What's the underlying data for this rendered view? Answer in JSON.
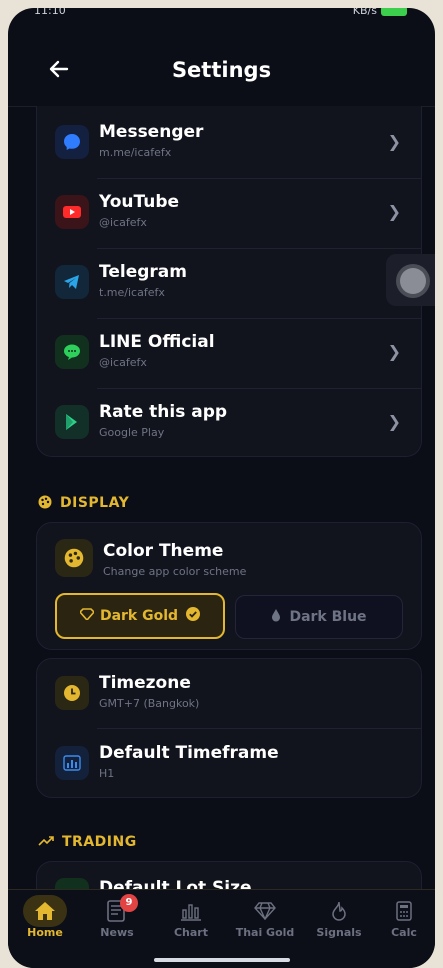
{
  "status": {
    "time": "11:10",
    "right": "KB/s"
  },
  "header": {
    "title": "Settings"
  },
  "social": [
    {
      "label": "Messenger",
      "sub": "m.me/icafefx",
      "icon": "messenger-icon",
      "color": "#2f7cff"
    },
    {
      "label": "YouTube",
      "sub": "@icafefx",
      "icon": "youtube-icon",
      "color": "#ff2a2a"
    },
    {
      "label": "Telegram",
      "sub": "t.me/icafefx",
      "icon": "telegram-icon",
      "color": "#2aa5e8"
    },
    {
      "label": "LINE Official",
      "sub": "@icafefx",
      "icon": "line-icon",
      "color": "#2fcf5c"
    },
    {
      "label": "Rate this app",
      "sub": "Google Play",
      "icon": "google-play-icon",
      "color": "#2fcf8a"
    }
  ],
  "display": {
    "section_label": "DISPLAY",
    "color_theme_title": "Color Theme",
    "color_theme_sub": "Change app color scheme",
    "dark_gold": "Dark Gold",
    "dark_blue": "Dark Blue",
    "selected": "Dark Gold"
  },
  "timezone": {
    "title": "Timezone",
    "sub": "GMT+7 (Bangkok)"
  },
  "timeframe": {
    "title": "Default Timeframe",
    "sub": "H1"
  },
  "trading": {
    "section_label": "TRADING",
    "first_item": "Default Lot Size"
  },
  "nav": [
    {
      "label": "Home",
      "icon": "home-icon",
      "active": true
    },
    {
      "label": "News",
      "icon": "news-icon",
      "badge": "9"
    },
    {
      "label": "Chart",
      "icon": "bar-chart-icon"
    },
    {
      "label": "Thai Gold",
      "icon": "diamond-icon"
    },
    {
      "label": "Signals",
      "icon": "flame-icon"
    },
    {
      "label": "Calc",
      "icon": "calculator-icon"
    }
  ],
  "colors": {
    "accent": "#e3b72f",
    "background": "#0b0d17"
  }
}
